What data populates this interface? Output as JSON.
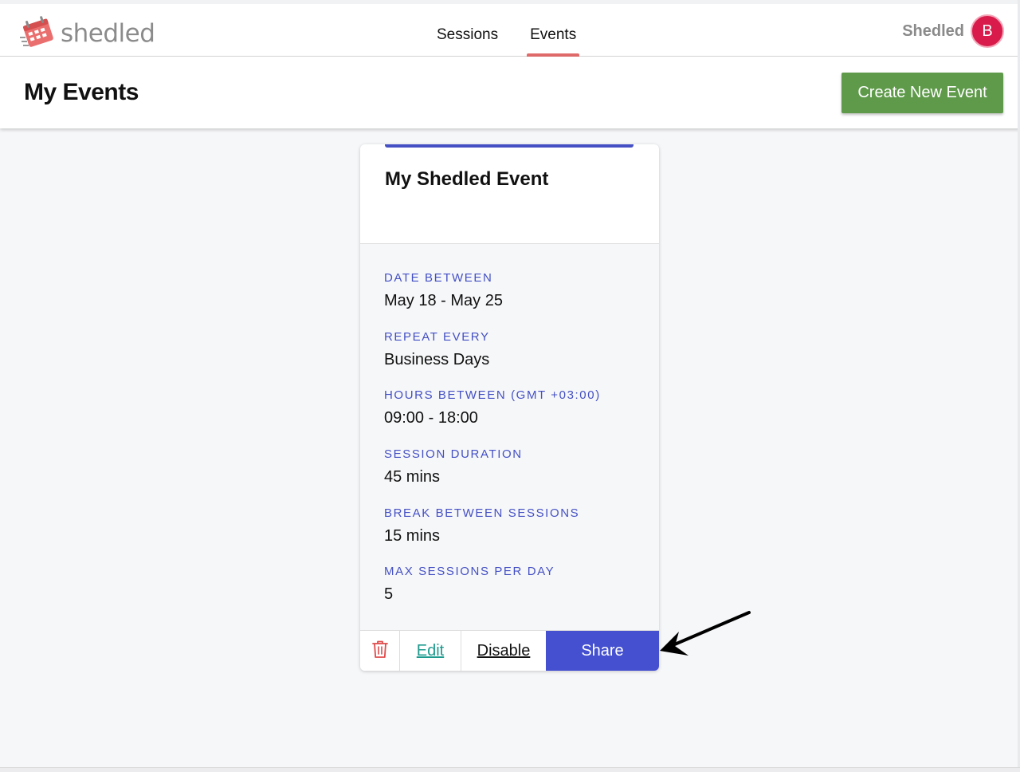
{
  "brand": {
    "name": "shedled"
  },
  "nav": {
    "tabs": [
      {
        "label": "Sessions",
        "active": false
      },
      {
        "label": "Events",
        "active": true
      }
    ]
  },
  "user": {
    "name": "Shedled",
    "avatar_initial": "B"
  },
  "page": {
    "title": "My Events",
    "create_button": "Create New Event"
  },
  "event_card": {
    "title": "My Shedled Event",
    "fields": [
      {
        "label": "DATE BETWEEN",
        "value": "May 18 - May 25"
      },
      {
        "label": "REPEAT EVERY",
        "value": "Business Days"
      },
      {
        "label": "HOURS BETWEEN (GMT +03:00)",
        "value": "09:00 - 18:00"
      },
      {
        "label": "SESSION DURATION",
        "value": "45 mins"
      },
      {
        "label": "BREAK BETWEEN SESSIONS",
        "value": "15 mins"
      },
      {
        "label": "MAX SESSIONS PER DAY",
        "value": "5"
      }
    ],
    "actions": {
      "edit": "Edit",
      "disable": "Disable",
      "share": "Share"
    }
  },
  "colors": {
    "accent": "#4450cf",
    "create_button": "#5f9a4b",
    "avatar": "#d81b4a",
    "active_tab_indicator": "#e06a6a",
    "edit_link": "#1d9a8e",
    "delete_icon": "#e04a4a"
  }
}
